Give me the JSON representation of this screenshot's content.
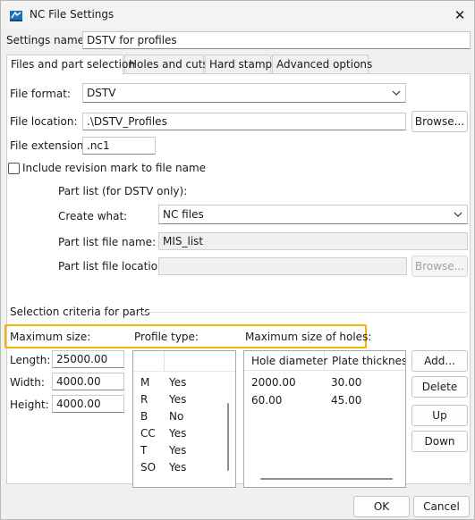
{
  "window": {
    "title": "NC File Settings",
    "close_glyph": "✕"
  },
  "settings_name": {
    "label": "Settings name:",
    "value": "DSTV for profiles"
  },
  "tabs": [
    {
      "label": "Files and part selection",
      "active": true
    },
    {
      "label": "Holes and cuts",
      "active": false
    },
    {
      "label": "Hard stamp",
      "active": false
    },
    {
      "label": "Advanced options",
      "active": false
    }
  ],
  "file_format": {
    "label": "File format:",
    "value": "DSTV"
  },
  "file_location": {
    "label": "File location:",
    "value": ".\\DSTV_Profiles",
    "browse_label": "Browse..."
  },
  "file_extension": {
    "label": "File extension:",
    "value": ".nc1"
  },
  "revision_mark": {
    "label": "Include revision mark to file name",
    "checked": false
  },
  "part_list": {
    "heading": "Part list (for DSTV only):",
    "create_what_label": "Create what:",
    "create_what_value": "NC files",
    "file_name_label": "Part list file name:",
    "file_name_value": "MIS_list",
    "file_location_label": "Part list file location:",
    "file_location_value": "",
    "browse_label": "Browse..."
  },
  "selection": {
    "heading": "Selection criteria for parts",
    "max_size_label": "Maximum size:",
    "profile_type_label": "Profile type:",
    "max_holes_label": "Maximum size of holes:",
    "length_label": "Length:",
    "length_value": "25000.00",
    "width_label": "Width:",
    "width_value": "4000.00",
    "height_label": "Height:",
    "height_value": "4000.00"
  },
  "profile_types": [
    {
      "code": "M",
      "value": "Yes"
    },
    {
      "code": "R",
      "value": "Yes"
    },
    {
      "code": "B",
      "value": "No"
    },
    {
      "code": "CC",
      "value": "Yes"
    },
    {
      "code": "T",
      "value": "Yes"
    },
    {
      "code": "SO",
      "value": "Yes"
    }
  ],
  "holes_table": {
    "headers": [
      "Hole diameter",
      "Plate thickness"
    ],
    "rows": [
      [
        "2000.00",
        "30.00"
      ],
      [
        "60.00",
        "45.00"
      ]
    ]
  },
  "side_buttons": {
    "add": "Add...",
    "delete": "Delete",
    "up": "Up",
    "down": "Down"
  },
  "footer": {
    "ok": "OK",
    "cancel": "Cancel"
  },
  "colors": {
    "highlight": "#f5b400",
    "icon_blue": "#1f6fb5"
  }
}
